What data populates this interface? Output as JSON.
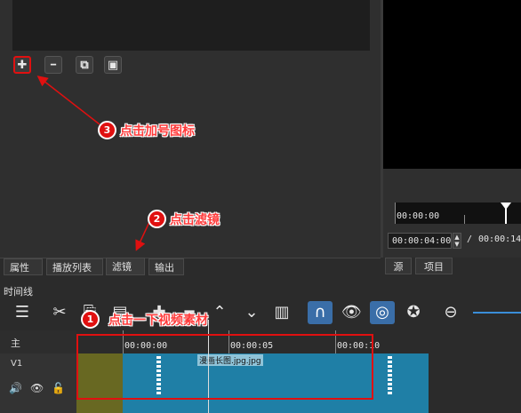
{
  "filters": {
    "buttons": [
      {
        "icon": "plus-icon",
        "glyph": "✚"
      },
      {
        "icon": "minus-icon",
        "glyph": "━"
      },
      {
        "icon": "copy-icon",
        "glyph": "⧉"
      },
      {
        "icon": "paste-icon",
        "glyph": "▣"
      }
    ]
  },
  "annotations": {
    "step1": {
      "num": "1",
      "text": "点击一下视频素材"
    },
    "step2": {
      "num": "2",
      "text": "点击滤镜"
    },
    "step3": {
      "num": "3",
      "text": "点击加号图标"
    }
  },
  "tabs": [
    "属性",
    "播放列表",
    "滤镜",
    "输出"
  ],
  "right_tabs": [
    "源",
    "项目"
  ],
  "player": {
    "ruler_time": "00:00:00",
    "position": "00:00:04:00",
    "separator": "/",
    "duration": "00:00:14"
  },
  "timeline": {
    "title": "时间线",
    "master_label": "主",
    "track_label": "V1",
    "ruler": [
      "00:00:00",
      "00:00:05",
      "00:00:10"
    ],
    "clip_name": "漫画长图.jpg.jpg"
  },
  "colors": {
    "accent": "#e01010",
    "clip": "#1f7fa6",
    "track": "#686822"
  }
}
